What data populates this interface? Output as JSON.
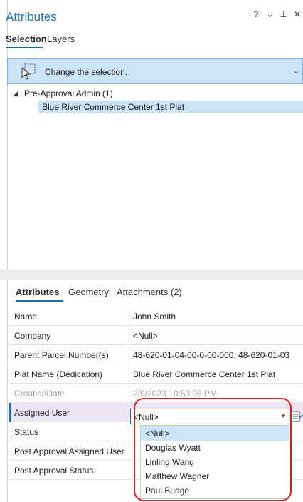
{
  "pane": {
    "title": "Attributes",
    "ctrl_help": "?",
    "ctrl_menu": "⌄",
    "ctrl_pin": "⊥",
    "ctrl_close": "✕"
  },
  "tabs": {
    "selection": "Selection",
    "layers": "Layers"
  },
  "change_selection": {
    "label": "Change the selection.",
    "chevron": "⌄",
    "icon": "selection-cursor-icon"
  },
  "tree": {
    "parent": "Pre-Approval Admin (1)",
    "child": "Blue River Commerce Center 1st Plat"
  },
  "lower_tabs": {
    "attributes": "Attributes",
    "geometry": "Geometry",
    "attachments": "Attachments (2)"
  },
  "rows": [
    {
      "name": "Name",
      "value": "John Smith"
    },
    {
      "name": "Company",
      "value": "<Null>"
    },
    {
      "name": "Parent Parcel Number(s)",
      "value": "48-620-01-04-00-0-00-000, 48-620-01-03"
    },
    {
      "name": "Plat Name (Dedication)",
      "value": "Blue River Commerce Center 1st Plat"
    },
    {
      "name": "CreationDate",
      "value": "2/9/2023 10:50:06 PM"
    },
    {
      "name": "Assigned User",
      "value": ""
    },
    {
      "name": "Status",
      "value": ""
    },
    {
      "name": "Post Approval Assigned User",
      "value": ""
    },
    {
      "name": "Post Approval Status",
      "value": ""
    }
  ],
  "dropdown": {
    "current": "<Null>",
    "options": [
      "<Null>",
      "Douglas Wyatt",
      "Linling Wang",
      "Matthew Wagner",
      "Paul Budge"
    ],
    "selected_index": 0
  },
  "colors": {
    "accent": "#1f6fb2",
    "selection": "#cce4f7",
    "highlight": "#e21a22",
    "active_row": "#ede5f4"
  }
}
